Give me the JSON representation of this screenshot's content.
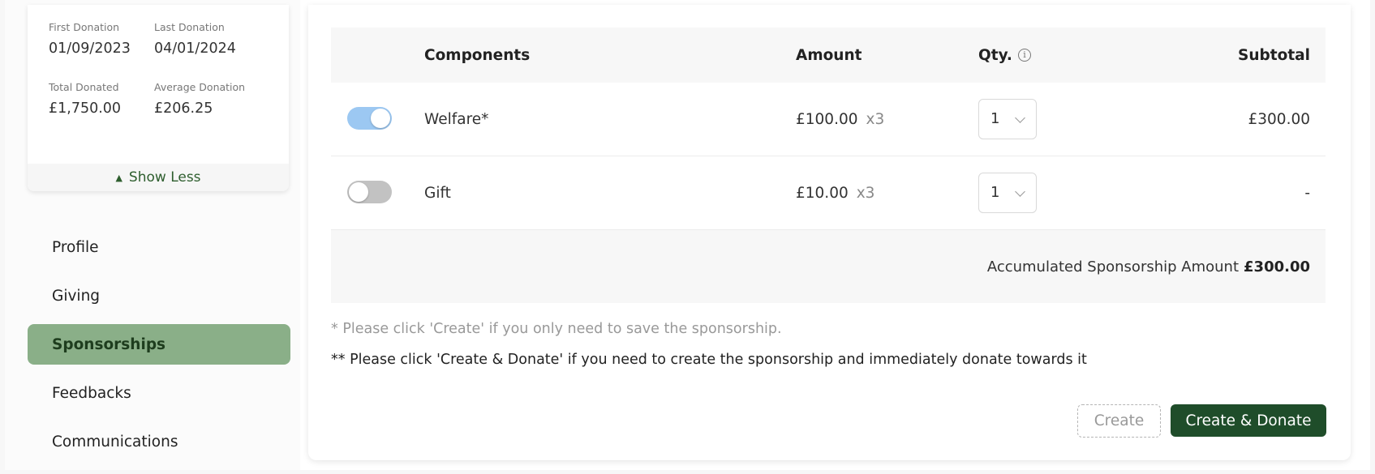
{
  "summary": {
    "first_donation_label": "First Donation",
    "first_donation_value": "01/09/2023",
    "last_donation_label": "Last Donation",
    "last_donation_value": "04/01/2024",
    "total_donated_label": "Total Donated",
    "total_donated_value": "£1,750.00",
    "average_donation_label": "Average Donation",
    "average_donation_value": "£206.25",
    "show_less_label": "Show Less"
  },
  "sidebar": {
    "items": [
      {
        "label": "Profile"
      },
      {
        "label": "Giving"
      },
      {
        "label": "Sponsorships",
        "active": true
      },
      {
        "label": "Feedbacks"
      },
      {
        "label": "Communications"
      }
    ]
  },
  "table": {
    "headers": {
      "components": "Components",
      "amount": "Amount",
      "qty": "Qty.",
      "subtotal": "Subtotal"
    },
    "rows": [
      {
        "enabled": true,
        "component": "Welfare*",
        "amount": "£100.00",
        "multiplier": "x3",
        "qty": "1",
        "subtotal": "£300.00"
      },
      {
        "enabled": false,
        "component": "Gift",
        "amount": "£10.00",
        "multiplier": "x3",
        "qty": "1",
        "subtotal": "-"
      }
    ],
    "total_label": "Accumulated Sponsorship Amount",
    "total_value": "£300.00"
  },
  "notes": {
    "create_note": "* Please click 'Create' if you only need to save the sponsorship.",
    "donate_note": "** Please click 'Create & Donate' if you need to create the sponsorship and immediately donate towards it"
  },
  "actions": {
    "create_label": "Create",
    "create_donate_label": "Create & Donate"
  },
  "colors": {
    "accent": "#1f4d2a",
    "active_nav": "#8aaf88",
    "toggle_on": "#9cc8f2",
    "toggle_off": "#c2c2c2"
  }
}
